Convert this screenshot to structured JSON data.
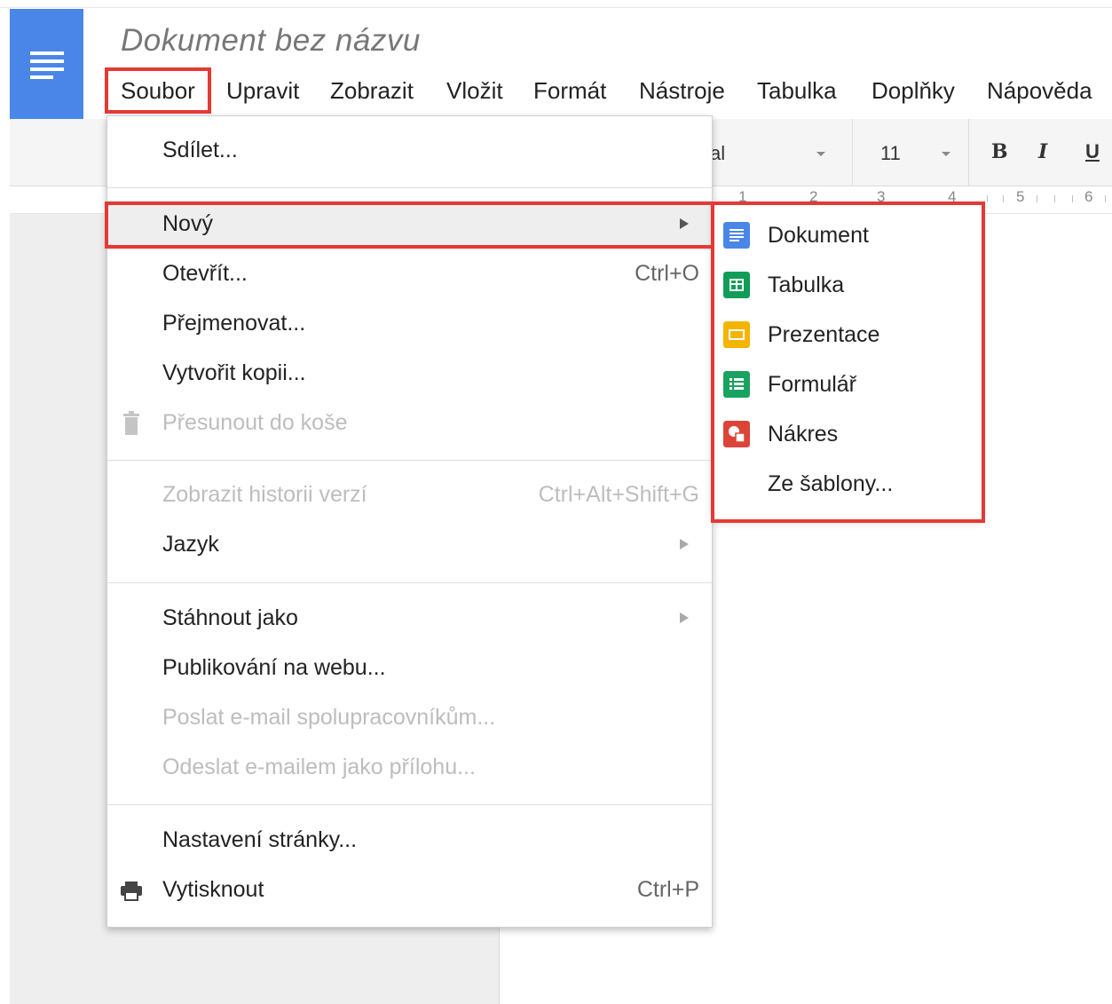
{
  "document_title": "Dokument bez názvu",
  "menubar": [
    "Soubor",
    "Upravit",
    "Zobrazit",
    "Vložit",
    "Formát",
    "Nástroje",
    "Tabulka",
    "Doplňky",
    "Nápověda"
  ],
  "toolbar": {
    "font_partial": "al",
    "font_size": "11",
    "bold": "B",
    "italic": "I",
    "underline": "U"
  },
  "ruler": [
    "1",
    "2",
    "3",
    "4",
    "5",
    "6"
  ],
  "file_menu": {
    "share": "Sdílet...",
    "new": "Nový",
    "open": "Otevřít...",
    "open_sc": "Ctrl+O",
    "rename": "Přejmenovat...",
    "copy": "Vytvořit kopii...",
    "trash": "Přesunout do koše",
    "history": "Zobrazit historii verzí",
    "history_sc": "Ctrl+Alt+Shift+G",
    "language": "Jazyk",
    "download": "Stáhnout jako",
    "publish": "Publikování na webu...",
    "email_collab": "Poslat e-mail spolupracovníkům...",
    "email_attach": "Odeslat e-mailem jako přílohu...",
    "page_setup": "Nastavení stránky...",
    "print": "Vytisknout",
    "print_sc": "Ctrl+P"
  },
  "new_submenu": {
    "document": "Dokument",
    "spreadsheet": "Tabulka",
    "presentation": "Prezentace",
    "form": "Formulář",
    "drawing": "Nákres",
    "template": "Ze šablony..."
  },
  "colors": {
    "accent_blue": "#4a86e8",
    "sheets_green": "#0f9d58",
    "slides_yellow": "#f4b400",
    "forms_green": "#1aa260",
    "drawing_red": "#db4437",
    "highlight_red": "#e53935"
  }
}
